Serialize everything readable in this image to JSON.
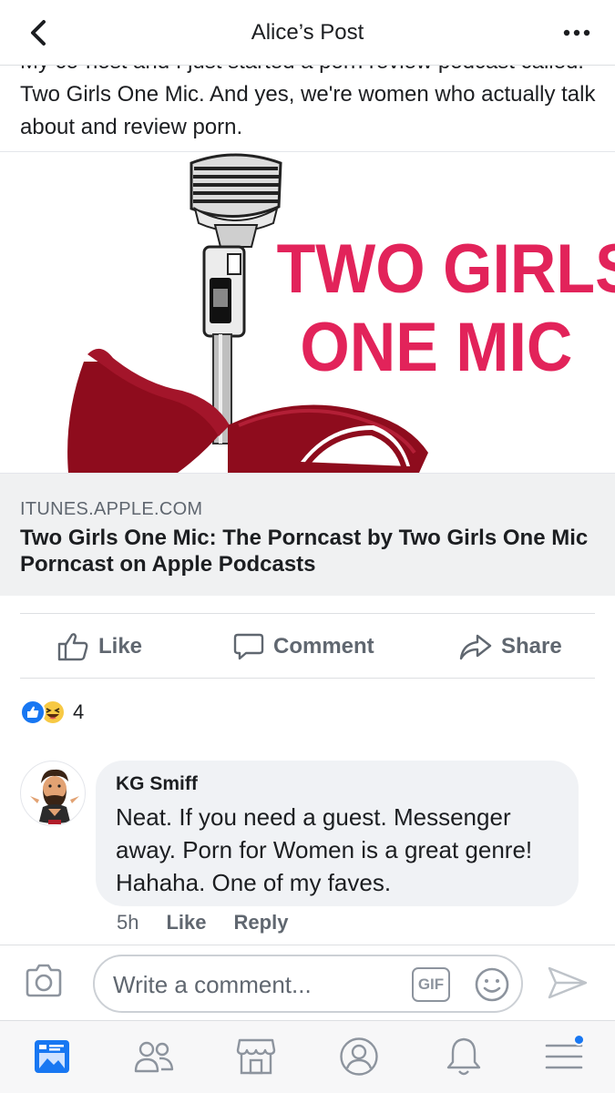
{
  "header": {
    "title": "Alice’s Post",
    "back_icon": "chevron-left-icon",
    "more_icon": "more-dots-icon"
  },
  "post": {
    "text": "My co-host and I just started a porn review podcast called: Two Girls One Mic. And yes, we're women who actually talk about and review porn."
  },
  "link_card": {
    "image_text_line1": "TWO GIRLS",
    "image_text_line2": "ONE MIC",
    "domain": "ITUNES.APPLE.COM",
    "title": "Two Girls One Mic: The Porncast by Two Girls One Mic Porncast on Apple Podcasts"
  },
  "actions": {
    "like_label": "Like",
    "comment_label": "Comment",
    "share_label": "Share"
  },
  "reactions": {
    "types": [
      "like",
      "haha"
    ],
    "count": "4"
  },
  "comment": {
    "author": "KG Smiff",
    "text": "Neat. If you need a guest. Messenger away. Porn for Women is a great genre! Hahaha. One of my faves.",
    "time": "5h",
    "like_label": "Like",
    "reply_label": "Reply"
  },
  "composer": {
    "placeholder": "Write a comment...",
    "gif_label": "GIF"
  },
  "tabbar": {
    "items": [
      "news-feed",
      "friends",
      "marketplace",
      "profile",
      "notifications",
      "menu"
    ]
  },
  "colors": {
    "brand_blue": "#1877f2",
    "podcast_pink": "#e2235a",
    "bra_red": "#8e0c1d",
    "link_meta_bg": "#f0f1f2"
  }
}
